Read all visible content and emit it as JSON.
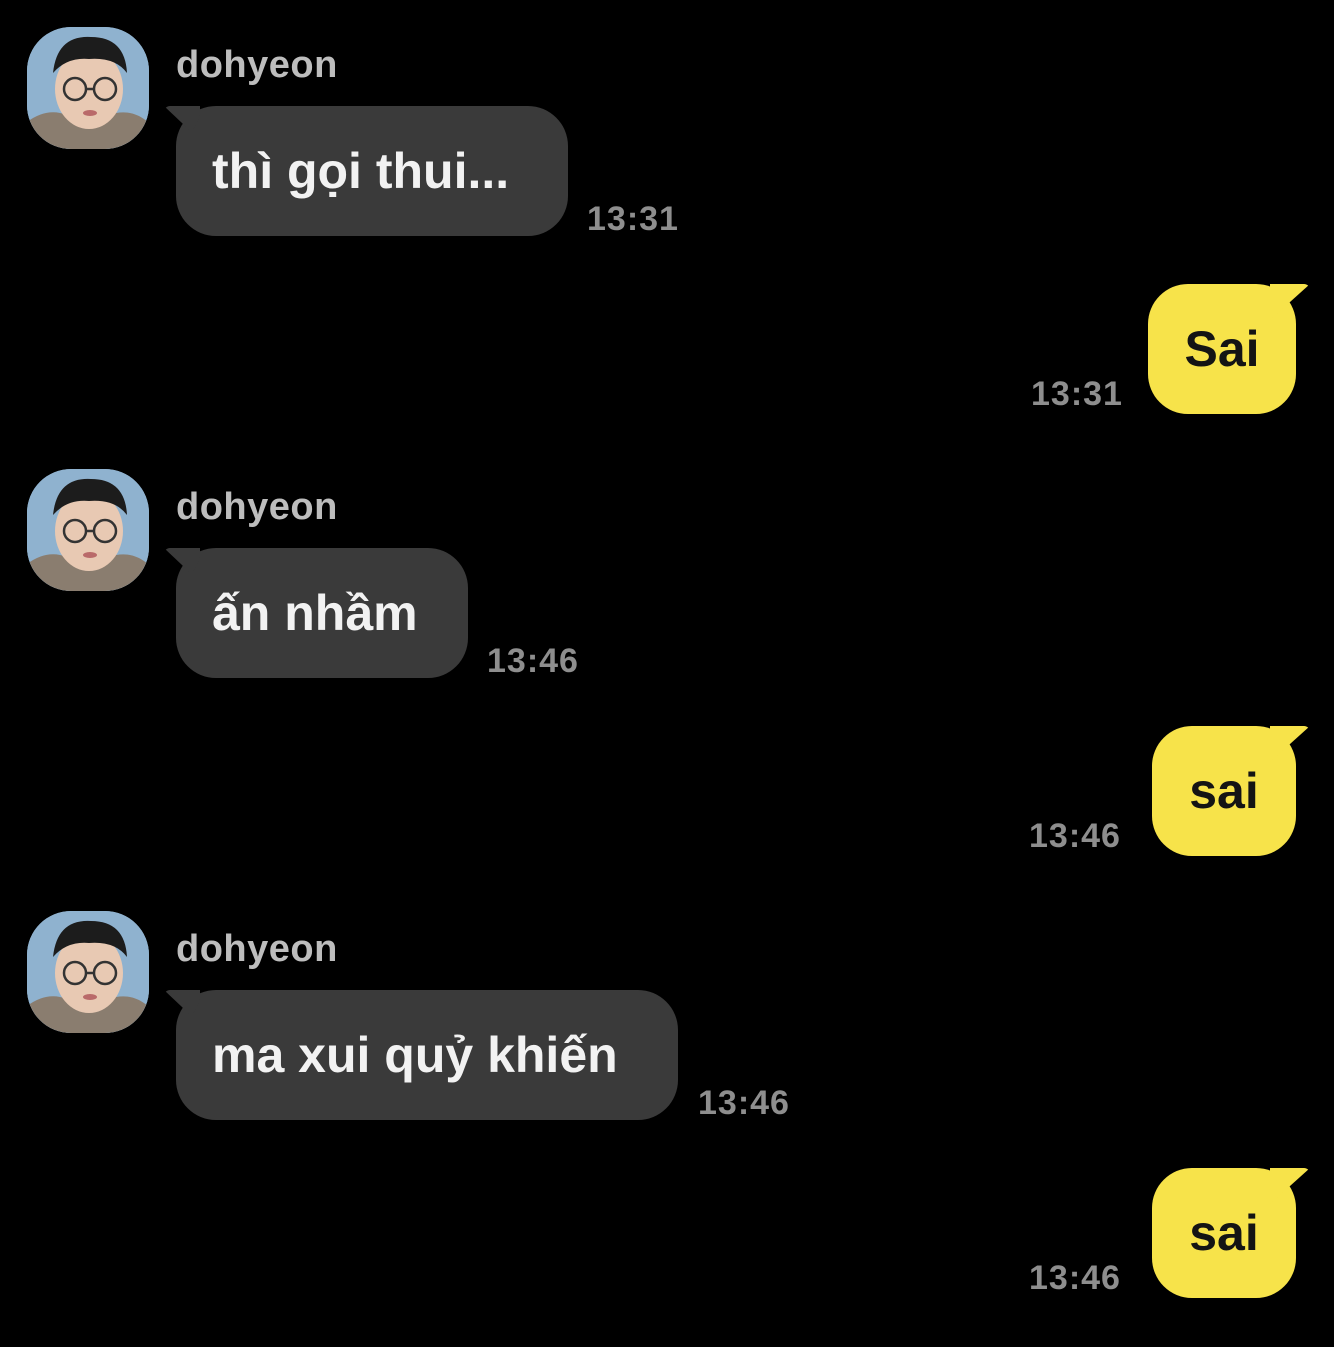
{
  "chat": {
    "contact_name": "dohyeon",
    "colors": {
      "background": "#000000",
      "incoming_bubble": "#3a3a3a",
      "outgoing_bubble": "#f7e34a",
      "timestamp": "#8e8e8e",
      "sender_name": "#bdbdbd"
    },
    "messages": [
      {
        "direction": "incoming",
        "sender": "dohyeon",
        "text": "thì gọi thui...",
        "time": "13:31"
      },
      {
        "direction": "outgoing",
        "text": "Sai",
        "time": "13:31"
      },
      {
        "direction": "incoming",
        "sender": "dohyeon",
        "text": "ấn nhầm",
        "time": "13:46"
      },
      {
        "direction": "outgoing",
        "text": "sai",
        "time": "13:46"
      },
      {
        "direction": "incoming",
        "sender": "dohyeon",
        "text": "ma xui quỷ khiến",
        "time": "13:46"
      },
      {
        "direction": "outgoing",
        "text": "sai",
        "time": "13:46"
      }
    ]
  }
}
